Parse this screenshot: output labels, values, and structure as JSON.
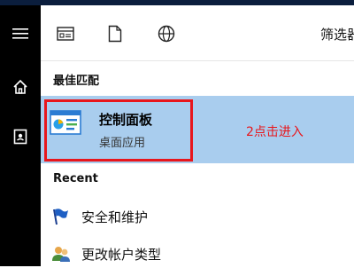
{
  "filters": {
    "filter_label": "筛选器"
  },
  "best_match": {
    "heading": "最佳匹配",
    "title": "控制面板",
    "subtitle": "桌面应用",
    "annotation": "2点击进入"
  },
  "recent": {
    "heading": "Recent",
    "items": [
      {
        "label": "安全和维护",
        "icon": "security-flag-icon"
      },
      {
        "label": "更改帐户类型",
        "icon": "users-icon"
      }
    ]
  },
  "colors": {
    "highlight": "#a9cdee",
    "annotation_red": "#e8161c",
    "rail": "#000000"
  }
}
